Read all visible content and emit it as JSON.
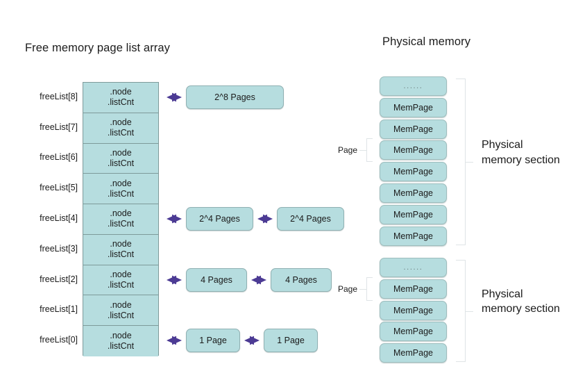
{
  "titles": {
    "freelist_array": "Free memory page list array",
    "physical_memory": "Physical memory"
  },
  "colors": {
    "box_fill": "#b6dddf",
    "box_border": "#7e9a9a",
    "arrow": "#4c3b94",
    "bracket": "#dfe4e6",
    "text": "#1a1a1a"
  },
  "freelist": {
    "cell_line1": ".node",
    "cell_line2": ".listCnt",
    "entries": [
      {
        "label": "freeList[8]",
        "chain": [
          "2^8 Pages"
        ]
      },
      {
        "label": "freeList[7]",
        "chain": []
      },
      {
        "label": "freeList[6]",
        "chain": []
      },
      {
        "label": "freeList[5]",
        "chain": []
      },
      {
        "label": "freeList[4]",
        "chain": [
          "2^4 Pages",
          "2^4 Pages"
        ]
      },
      {
        "label": "freeList[3]",
        "chain": []
      },
      {
        "label": "freeList[2]",
        "chain": [
          "4 Pages",
          "4 Pages"
        ]
      },
      {
        "label": "freeList[1]",
        "chain": []
      },
      {
        "label": "freeList[0]",
        "chain": [
          "1 Page",
          "1 Page"
        ]
      }
    ]
  },
  "physical_memory": {
    "dots_label": "......",
    "page_label": "MemPage",
    "page_tick_label": "Page",
    "section_label": "Physical memory section",
    "sections": [
      {
        "boxes": [
          "......",
          "MemPage",
          "MemPage",
          "MemPage",
          "MemPage",
          "MemPage",
          "MemPage",
          "MemPage"
        ]
      },
      {
        "boxes": [
          "......",
          "MemPage",
          "MemPage",
          "MemPage",
          "MemPage"
        ]
      }
    ]
  }
}
